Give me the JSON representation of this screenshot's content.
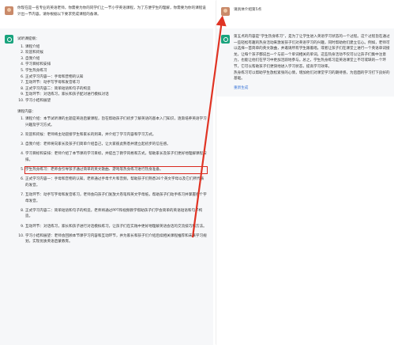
{
  "left": {
    "user_prompt": "你现在是一名专业的英语老师，你需要为你的同学们上一节小学英语课程，为了方便学生的理解，你需要为你的课程设计出一节内容。请你根据以下要求完成课程的备课。",
    "intro_title": "试听课提纲：",
    "outline": [
      "课程介绍",
      "欢迎和问候",
      "自我介绍",
      "学习目标和安排",
      "学生热身练习",
      "正式学习内容一：手母和普物的认知",
      "互动环节：动手写字母和发音练习",
      "正式学习内容二：简单短语和句子的构造",
      "互动环节：对话练习，家长和孩子配对进行模拟对话",
      "学习小结和展望"
    ],
    "course_title": "课程内容：",
    "course": [
      "课程介绍：本节试听课的主题是英语启蒙课程，旨在帮助孩子们初步了解英语的基本入门知识，逐渐培养英语学习兴趣及学习方式。",
      "欢迎和问候：老师将主动迎接学生和家长的到来，并介绍了学习内容和学习方式。",
      "自我介绍：老师将向家长及孩子们简单介绍自己，让大家彼此熟悉并建立起初步的信任感。",
      "学习目标和安排：老师介绍了本节课的学习目标，并提出了教学风格和方式，帮助家长及孩子们更好地理解课程安排。",
      "学生热身练习：老师会引导孩子通过简单的英文歌曲、游戏等热身练习进行热身准备。",
      "正式学习内容一：手母和音物的认知，老师通过手母卡片和音频，帮助孩子们熟悉26个英文字母以及它们所代表的发音。",
      "互动环节：动手写字母和发音练习，老师会向孩子们发放大卷笔和英文字母纸，帮助孩子们动手练习并掌握各个字母发音。",
      "正式学习内容二：简单短语和句子的构造，老师将通过PPT和视频教学帮助孩子们学会简单的英语短语和句子构造。",
      "互动环节：对话练习，家长和孩子进行对话模拟练习，让孩子们在实践中更好地理解英语会话的交流技巧和方法。",
      "学习小结和展望：老师会回顾本节课学习内容和互动环节，并为家长和孩子们介绍后续相关课程推荐和未来学习规划，实现优质英语启蒙教育。"
    ]
  },
  "right": {
    "user_prompt": "请具体介绍第5点",
    "answer": "第五点的内容是“学生热身练习”，是为了让学生进入英语学习状态的一个过程。这个过程旨在通过一些轻松有趣的热身活动来激发孩子们对英语学习的兴趣，同时帮助他们建立信心。例如，老师可以选择一首简单的英文歌曲，并邀请所有学生跟着唱。或者让孩子们在课堂上进行一个英语单词接龙，让每个孩子都说出一个与前一个单词相关的单词。这些热身活动不仅可以让孩子们集中注意力，也能让他们在学习中更加活跃地参与。总之，学生热身练习是英语课堂上不可或缺的一个环节，它可以帮助孩子们更快地进入学习状态，提高学习效率。",
    "extra": "热身练习可以帮助学生放松紧张的心情，增加他们对课堂学习的期待感，为后面的学习打下良好的基础。",
    "link_label": "重新生成"
  }
}
